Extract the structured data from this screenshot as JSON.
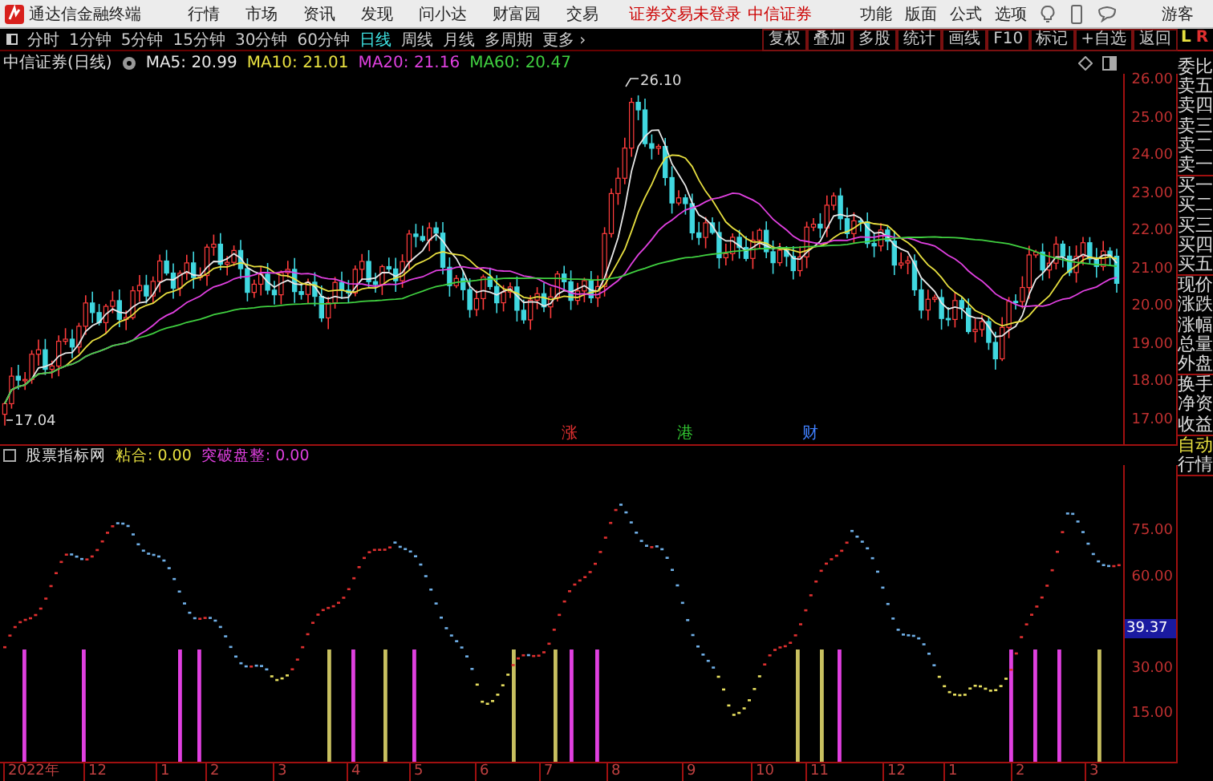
{
  "menubar": {
    "app_title": "通达信金融终端",
    "menus": [
      "行情",
      "市场",
      "资讯",
      "发现",
      "问小达",
      "财富园",
      "交易"
    ],
    "login_status": "证券交易未登录",
    "broker": "中信证券",
    "tools": [
      "功能",
      "版面",
      "公式",
      "选项"
    ],
    "user": "游客"
  },
  "toolbar": {
    "periods": [
      {
        "label": "分时",
        "selected": false
      },
      {
        "label": "1分钟",
        "selected": false
      },
      {
        "label": "5分钟",
        "selected": false
      },
      {
        "label": "15分钟",
        "selected": false
      },
      {
        "label": "30分钟",
        "selected": false
      },
      {
        "label": "60分钟",
        "selected": false
      },
      {
        "label": "日线",
        "selected": true
      },
      {
        "label": "周线",
        "selected": false
      },
      {
        "label": "月线",
        "selected": false
      },
      {
        "label": "多周期",
        "selected": false
      },
      {
        "label": "更多 ›",
        "selected": false
      }
    ],
    "actions": [
      "复权",
      "叠加",
      "多股",
      "统计",
      "画线",
      "F10",
      "标记",
      "+自选",
      "返回"
    ]
  },
  "price_chart": {
    "title": "中信证券(日线)",
    "moving_averages": [
      {
        "label": "MA5: 20.99",
        "color": "#e8e8e8"
      },
      {
        "label": "MA10: 21.01",
        "color": "#e8e040"
      },
      {
        "label": "MA20: 21.16",
        "color": "#e040e0"
      },
      {
        "label": "MA60: 20.47",
        "color": "#40d040"
      }
    ],
    "high_label": "26.10",
    "low_label": "17.04",
    "y_ticks": [
      "26.00",
      "25.00",
      "24.00",
      "23.00",
      "22.00",
      "21.00",
      "20.00",
      "19.00",
      "18.00",
      "17.00"
    ],
    "event_markers": [
      {
        "label": "涨",
        "color": "#e03030"
      },
      {
        "label": "港",
        "color": "#30c030"
      },
      {
        "label": "财",
        "color": "#4080ff"
      }
    ]
  },
  "indicator": {
    "items": [
      {
        "label": "股票指标网",
        "color": "#e0e0e0"
      },
      {
        "label": "粘合: 0.00",
        "color": "#e8e040"
      },
      {
        "label": "突破盘整: 0.00",
        "color": "#e040e0"
      }
    ],
    "y_ticks": [
      "75.00",
      "60.00",
      "30.00",
      "15.00"
    ],
    "current_value": "39.37"
  },
  "date_axis": [
    "2022年",
    "12",
    "1",
    "2",
    "3",
    "4",
    "5",
    "6",
    "7",
    "8",
    "9",
    "10",
    "11",
    "12",
    "1",
    "2",
    "3"
  ],
  "sidebar": {
    "left_tab": "L",
    "right_tab": "R",
    "groups": [
      [
        "委比",
        "卖五",
        "卖四",
        "卖三",
        "卖二",
        "卖一"
      ],
      [
        "买一",
        "买二",
        "买三",
        "买四",
        "买五"
      ],
      [
        "现价",
        "涨跌",
        "涨幅",
        "总量",
        "外盘"
      ],
      [
        "换手",
        "净资",
        "收益"
      ]
    ],
    "auto_label": "自动",
    "market_label": "行情"
  }
}
